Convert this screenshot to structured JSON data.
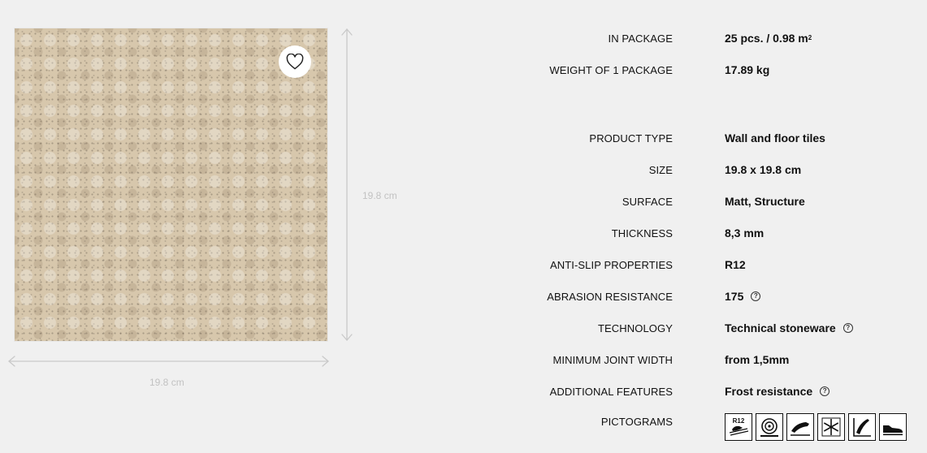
{
  "product": {
    "favorite_icon": "heart-icon",
    "dimension_vertical": "19.8 cm",
    "dimension_horizontal": "19.8 cm"
  },
  "specs": {
    "in_package": {
      "label": "IN PACKAGE",
      "value": "25 pcs. / 0.98 m",
      "sup": "2"
    },
    "weight": {
      "label": "WEIGHT OF 1 PACKAGE",
      "value": "17.89 kg"
    },
    "product_type": {
      "label": "PRODUCT TYPE",
      "value": "Wall and floor tiles"
    },
    "size": {
      "label": "SIZE",
      "value": "19.8 x 19.8 cm"
    },
    "surface": {
      "label": "SURFACE",
      "value": "Matt, Structure"
    },
    "thickness": {
      "label": "THICKNESS",
      "value": "8,3 mm"
    },
    "anti_slip": {
      "label": "ANTI-SLIP PROPERTIES",
      "value": "R12"
    },
    "abrasion": {
      "label": "ABRASION RESISTANCE",
      "value": "175",
      "help": "?"
    },
    "technology": {
      "label": "TECHNOLOGY",
      "value": "Technical stoneware",
      "help": "?"
    },
    "joint": {
      "label": "MINIMUM JOINT WIDTH",
      "value": "from 1,5mm"
    },
    "features": {
      "label": "ADDITIONAL FEATURES",
      "value": "Frost resistance",
      "help": "?"
    },
    "pictograms": {
      "label": "PICTOGRAMS",
      "items": [
        {
          "icon": "r12-slip-icon",
          "text": "R12"
        },
        {
          "icon": "cutting-disc-icon"
        },
        {
          "icon": "wall-tile-icon"
        },
        {
          "icon": "snowflake-icon"
        },
        {
          "icon": "floor-tile-icon"
        },
        {
          "icon": "shoe-icon"
        }
      ]
    }
  }
}
